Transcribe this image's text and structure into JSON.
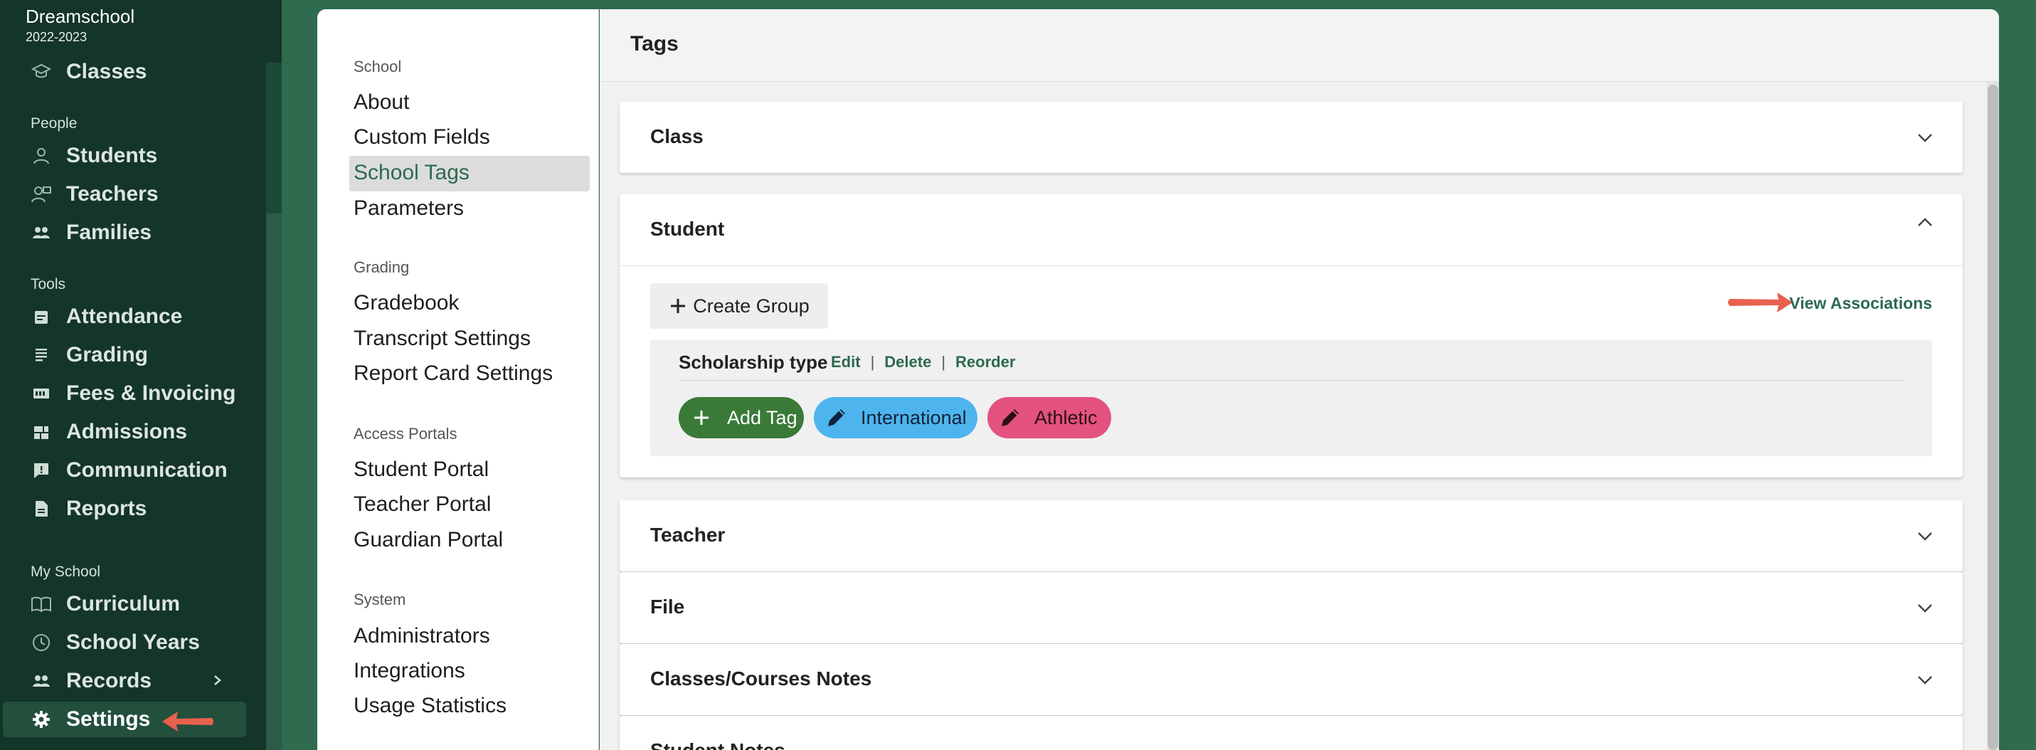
{
  "app": {
    "school_name": "Dreamschool",
    "school_year": "2022-2023"
  },
  "sidebar": {
    "top_item": {
      "label": "Classes",
      "icon": "mortarboard-icon"
    },
    "sections": [
      {
        "label": "People",
        "items": [
          {
            "label": "Students",
            "icon": "person-icon"
          },
          {
            "label": "Teachers",
            "icon": "teacher-icon"
          },
          {
            "label": "Families",
            "icon": "group-icon"
          }
        ]
      },
      {
        "label": "Tools",
        "items": [
          {
            "label": "Attendance",
            "icon": "calendar-icon"
          },
          {
            "label": "Grading",
            "icon": "gradebook-icon"
          },
          {
            "label": "Fees & Invoicing",
            "icon": "invoice-icon"
          },
          {
            "label": "Admissions",
            "icon": "admissions-icon"
          },
          {
            "label": "Communication",
            "icon": "message-icon"
          },
          {
            "label": "Reports",
            "icon": "report-icon"
          }
        ]
      },
      {
        "label": "My School",
        "items": [
          {
            "label": "Curriculum",
            "icon": "book-icon"
          },
          {
            "label": "School Years",
            "icon": "clock-icon"
          },
          {
            "label": "Records",
            "icon": "group-icon"
          },
          {
            "label": "Settings",
            "icon": "gear-icon"
          }
        ]
      }
    ]
  },
  "settings_nav": {
    "groups": [
      {
        "label": "School",
        "links": [
          "About",
          "Custom Fields",
          "School Tags",
          "Parameters"
        ]
      },
      {
        "label": "Grading",
        "links": [
          "Gradebook",
          "Transcript Settings",
          "Report Card Settings"
        ]
      },
      {
        "label": "Access Portals",
        "links": [
          "Student Portal",
          "Teacher Portal",
          "Guardian Portal"
        ]
      },
      {
        "label": "System",
        "links": [
          "Administrators",
          "Integrations",
          "Usage Statistics"
        ]
      }
    ],
    "active": "School Tags"
  },
  "main": {
    "title": "Tags",
    "cards": {
      "class": "Class",
      "student": "Student",
      "teacher": "Teacher",
      "file": "File",
      "classes_notes": "Classes/Courses Notes",
      "student_notes": "Student Notes"
    },
    "student_section": {
      "create_group_label": "Create Group",
      "view_associations_label": "View Associations",
      "group": {
        "name": "Scholarship type",
        "actions": [
          "Edit",
          "Delete",
          "Reorder"
        ],
        "add_tag_label": "Add Tag",
        "tags": [
          {
            "label": "International",
            "color": "#4eb4ee"
          },
          {
            "label": "Athletic",
            "color": "#e4527f"
          }
        ]
      }
    }
  },
  "colors": {
    "brand_green": "#2d6a4f",
    "sidebar_bg": "#14352a",
    "annotation_arrow": "#e8614f"
  }
}
